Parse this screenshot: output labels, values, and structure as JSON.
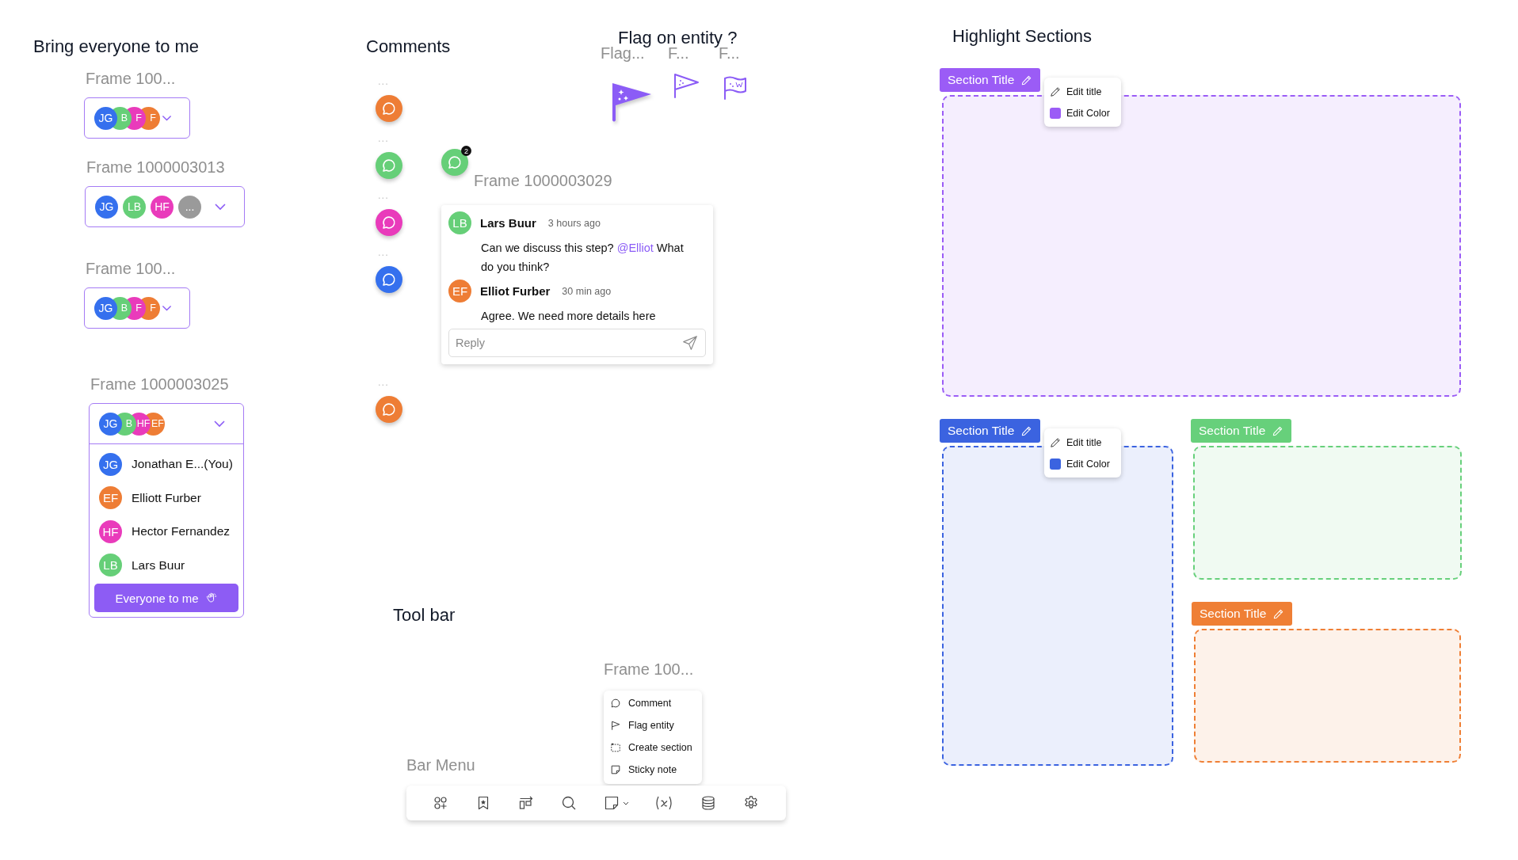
{
  "bring_everyone": {
    "title": "Bring everyone to me",
    "frames": [
      {
        "label": "Frame 100...",
        "expanded": false,
        "stacked": true,
        "avatars": [
          {
            "initials": "JG",
            "color": "#3570ee"
          },
          {
            "initials": "B",
            "color": "#66cf78"
          },
          {
            "initials": "F",
            "color": "#e93bbb"
          },
          {
            "initials": "F",
            "color": "#ee7d35"
          }
        ]
      },
      {
        "label": "Frame 1000003013",
        "expanded": false,
        "stacked": false,
        "avatars": [
          {
            "initials": "JG",
            "color": "#3570ee"
          },
          {
            "initials": "LB",
            "color": "#66cf78"
          },
          {
            "initials": "HF",
            "color": "#e93bbb"
          },
          {
            "initials": "...",
            "color": "#9a9a9a"
          }
        ]
      },
      {
        "label": "Frame 100...",
        "expanded": false,
        "stacked": true,
        "avatars": [
          {
            "initials": "JG",
            "color": "#3570ee"
          },
          {
            "initials": "B",
            "color": "#66cf78"
          },
          {
            "initials": "F",
            "color": "#e93bbb"
          },
          {
            "initials": "F",
            "color": "#ee7d35"
          }
        ]
      },
      {
        "label": "Frame 1000003025",
        "expanded": true,
        "stacked": true,
        "avatars": [
          {
            "initials": "JG",
            "color": "#3570ee"
          },
          {
            "initials": "B",
            "color": "#66cf78"
          },
          {
            "initials": "HF",
            "color": "#e93bbb"
          },
          {
            "initials": "EF",
            "color": "#ee7d35"
          }
        ],
        "members": [
          {
            "initials": "JG",
            "name": "Jonathan E...(You)",
            "color": "#3570ee"
          },
          {
            "initials": "EF",
            "name": "Elliott Furber",
            "color": "#ee7d35"
          },
          {
            "initials": "HF",
            "name": "Hector Fernandez",
            "color": "#e93bbb"
          },
          {
            "initials": "LB",
            "name": "Lars Buur",
            "color": "#66cf78"
          }
        ],
        "button": "Everyone to me"
      }
    ]
  },
  "comments": {
    "title": "Comments",
    "pins": [
      {
        "label": "...",
        "color": "#ee7d35"
      },
      {
        "label": "...",
        "color": "#66cf78"
      },
      {
        "label": "...",
        "color": "#e93bbb"
      },
      {
        "label": "...",
        "color": "#3570ee"
      },
      {
        "label": "...",
        "color": "#ee7d35"
      }
    ],
    "thread": {
      "frame_label": "Frame 1000003029",
      "pin": {
        "color": "#66cf78"
      },
      "badge": "2",
      "messages": [
        {
          "initials": "LB",
          "color": "#66cf78",
          "author": "Lars Buur",
          "time": "3 hours ago",
          "parts": [
            {
              "text": "Can we discuss this step? ",
              "kind": "plain"
            },
            {
              "text": "@Elliot",
              "kind": "mention"
            },
            {
              "text": " What do you think?",
              "kind": "plain"
            }
          ]
        },
        {
          "initials": "EF",
          "color": "#ee7d35",
          "author": "Elliot Furber",
          "time": "30 min ago",
          "parts": [
            {
              "text": "Agree. We need more details here",
              "kind": "plain"
            }
          ]
        }
      ],
      "reply": {
        "placeholder": "Reply"
      }
    }
  },
  "flag_on_entity": {
    "title": "Flag on entity ?",
    "options": [
      {
        "label": "Flag...",
        "kind": "filled"
      },
      {
        "label": "F...",
        "kind": "outline"
      },
      {
        "label": "F...",
        "kind": "wavy"
      }
    ]
  },
  "highlight_sections": {
    "title": "Highlight Sections",
    "sections": [
      {
        "title": "Section Title",
        "color": "#9b5cf6",
        "menu": [
          {
            "label": "Edit title",
            "kind": "title"
          },
          {
            "label": "Edit Color",
            "kind": "color"
          }
        ]
      },
      {
        "title": "Section Title",
        "color": "#3b63e0",
        "menu": [
          {
            "label": "Edit title",
            "kind": "title"
          },
          {
            "label": "Edit Color",
            "kind": "color"
          }
        ]
      },
      {
        "title": "Section Title",
        "color": "#67d07b"
      },
      {
        "title": "Section Title",
        "color": "#ef7f35"
      }
    ]
  },
  "tool_bar": {
    "title": "Tool bar",
    "menu_frame_label": "Frame 100...",
    "menu": [
      {
        "label": "Comment",
        "kind": "comment"
      },
      {
        "label": "Flag entity",
        "kind": "flag"
      },
      {
        "label": "Create section",
        "kind": "section"
      },
      {
        "label": "Sticky note",
        "kind": "sticky"
      }
    ],
    "bar_label": "Bar Menu"
  }
}
